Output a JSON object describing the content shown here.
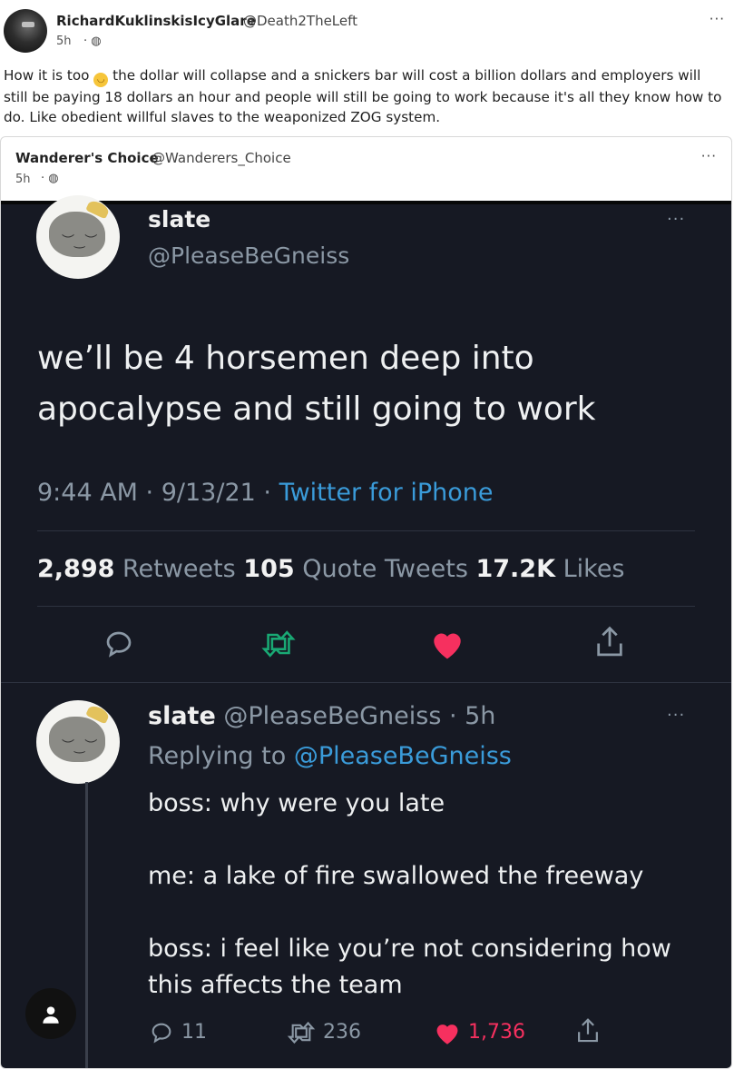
{
  "post": {
    "author_name": "RichardKuklinskisIcyGlare",
    "author_handle": "@Death2TheLeft",
    "time": "5h",
    "text_before_emoji": "How it is too ",
    "emoji_icon": "relieved-face-emoji",
    "text_after_emoji": " the dollar will collapse and a snickers bar will cost a billion dollars and employers will still be paying 18 dollars an hour and people will still be going to work because it's all they know how to do. Like obedient willful slaves to the weaponized ZOG system.",
    "more": "···"
  },
  "quoted_post": {
    "author_name": "Wanderer's Choice",
    "author_handle": "@Wanderers_Choice",
    "time": "5h",
    "more": "···"
  },
  "tweet": {
    "name": "slate",
    "handle": "@PleaseBeGneiss",
    "more": "···",
    "body_line1": "we’ll be 4 horsemen deep into",
    "body_line2": "apocalypse and still going to work",
    "timestamp": "9:44 AM · 9/13/21 · ",
    "source": "Twitter for iPhone",
    "retweets_count": "2,898",
    "retweets_label": " Retweets ",
    "quotes_count": "105",
    "quotes_label": " Quote Tweets ",
    "likes_count": "17.2K",
    "likes_label": " Likes"
  },
  "reply": {
    "name": "slate",
    "handle_time": " @PleaseBeGneiss · 5h",
    "replying_to_label": "Replying to ",
    "replying_to_handle": "@PleaseBeGneiss",
    "line1": "boss: why were you late",
    "line2": "me: a lake of fire swallowed the freeway",
    "line3": "boss: i feel like you’re not considering how",
    "line4": "this affects the team",
    "reply_count": "11",
    "retweet_count": "236",
    "like_count": "1,736",
    "more": "···"
  },
  "colors": {
    "twitter_bg": "#161923",
    "link_blue": "#3a9bd9",
    "retweet_green": "#19a974",
    "like_pink": "#f6305f"
  }
}
